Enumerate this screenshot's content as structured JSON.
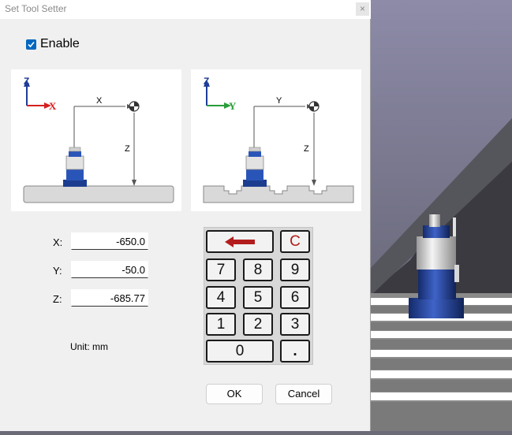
{
  "dialog": {
    "title": "Set Tool Setter",
    "close_glyph": "×",
    "enable": {
      "label": "Enable",
      "checked": true
    },
    "diagram_x": {
      "vertical_axis": "Z",
      "horizontal_axis": "X",
      "dim_horizontal": "X",
      "dim_vertical": "Z"
    },
    "diagram_y": {
      "vertical_axis": "Z",
      "horizontal_axis": "Y",
      "dim_horizontal": "Y",
      "dim_vertical": "Z"
    },
    "fields": [
      {
        "label": "X:",
        "value": "-650.0"
      },
      {
        "label": "Y:",
        "value": "-50.0"
      },
      {
        "label": "Z:",
        "value": "-685.77"
      }
    ],
    "unit": "Unit:  mm",
    "keypad": {
      "backspace_icon": "left-arrow-icon",
      "clear": "C",
      "digits": [
        "7",
        "8",
        "9",
        "4",
        "5",
        "6",
        "1",
        "2",
        "3"
      ],
      "zero": "0",
      "dot": "."
    },
    "ok_label": "OK",
    "cancel_label": "Cancel"
  },
  "colors": {
    "accent": "#0067c0",
    "z_axis": "#1f3d99",
    "x_axis": "#d42020",
    "y_axis": "#2a9d3a",
    "clear_key": "#b31c1c",
    "viewport_bg": "#6b6b78"
  }
}
